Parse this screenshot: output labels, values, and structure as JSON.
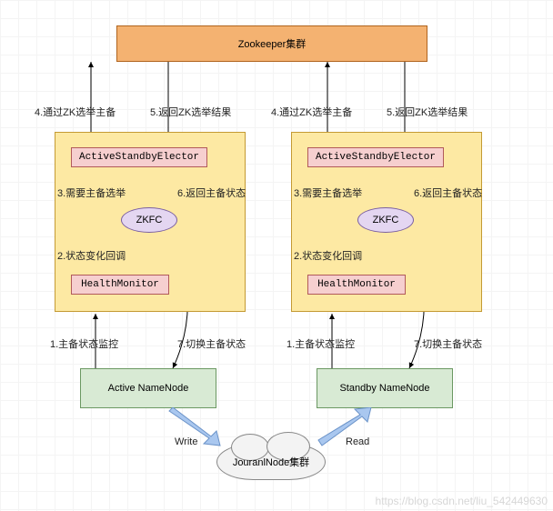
{
  "top": {
    "zookeeper": "Zookeeper集群"
  },
  "left": {
    "elector": "ActiveStandbyElector",
    "zkfc": "ZKFC",
    "health": "HealthMonitor",
    "namenode": "Active NameNode"
  },
  "right": {
    "elector": "ActiveStandbyElector",
    "zkfc": "ZKFC",
    "health": "HealthMonitor",
    "namenode": "Standby NameNode"
  },
  "labels": {
    "s1": "1.主备状态监控",
    "s2": "2.状态变化回调",
    "s3": "3.需要主备选举",
    "s4": "4.通过ZK选举主备",
    "s5": "5.返回ZK选举结果",
    "s6": "6.返回主备状态",
    "s7": "7.切换主备状态"
  },
  "io": {
    "write": "Write",
    "read": "Read"
  },
  "journal": "JouranlNode集群",
  "watermark": "https://blog.csdn.net/liu_542449630"
}
